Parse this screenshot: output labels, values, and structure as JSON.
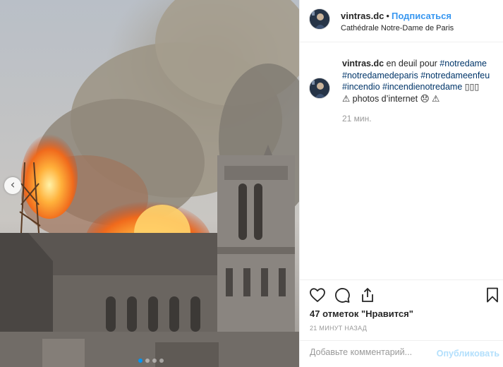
{
  "post": {
    "username": "vintras.dc",
    "separator": "•",
    "follow_label": "Подписаться",
    "location": "Cathédrale Notre-Dame de Paris"
  },
  "caption": {
    "username": "vintras.dc",
    "text_start": " en deuil pour ",
    "tags": [
      "#notredame",
      "#notredamedeparis",
      "#notredameenfeu",
      "#incendio",
      "#incendienotredame"
    ],
    "emoji_tail": " ▯▯▯",
    "line_tail": "⚠ photos d’internet 😞 ⚠",
    "time": "21 мин."
  },
  "actions": {
    "like_icon": "heart-icon",
    "comment_icon": "comment-bubble-icon",
    "share_icon": "share-upload-icon",
    "save_icon": "bookmark-icon"
  },
  "likes": "47 отметок \"Нравится\"",
  "timestamp": "21 МИНУТ НАЗАД",
  "comment_box": {
    "placeholder": "Добавьте комментарий...",
    "publish_label": "Опубликовать"
  },
  "carousel": {
    "prev_icon": "chevron-left-icon",
    "slide_count": 4,
    "active_slide": 1
  },
  "colors": {
    "link": "#003569",
    "follow": "#3897f0",
    "publish_disabled": "#b2dffc",
    "active_dot": "#0095f6"
  }
}
